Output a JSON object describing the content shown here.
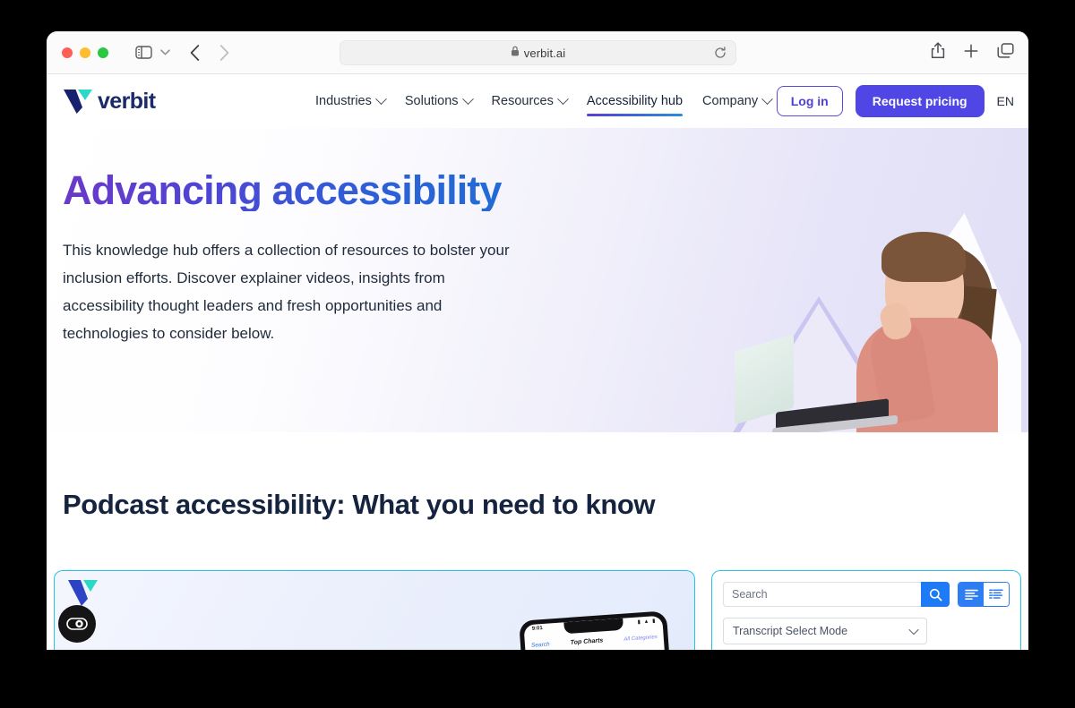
{
  "browser": {
    "url": "verbit.ai",
    "lock_icon": "lock-icon",
    "reload_icon": "reload-icon",
    "sidebar_icon": "sidebar-toggle-icon",
    "back_icon": "back-arrow-icon",
    "forward_icon": "forward-arrow-icon",
    "share_icon": "share-icon",
    "new_tab_icon": "plus-icon",
    "tab_overview_icon": "tab-overview-icon"
  },
  "header": {
    "logo_text": "verbit",
    "nav": [
      {
        "label": "Industries",
        "has_dropdown": true,
        "active": false
      },
      {
        "label": "Solutions",
        "has_dropdown": true,
        "active": false
      },
      {
        "label": "Resources",
        "has_dropdown": true,
        "active": false
      },
      {
        "label": "Accessibility hub",
        "has_dropdown": false,
        "active": true
      },
      {
        "label": "Company",
        "has_dropdown": true,
        "active": false
      }
    ],
    "login_label": "Log in",
    "request_pricing_label": "Request pricing",
    "language": "EN"
  },
  "hero": {
    "title": "Advancing accessibility",
    "paragraph": "This knowledge hub offers a collection of resources to bolster your inclusion efforts. Discover explainer videos, insights from accessibility thought leaders and fresh opportunities and technologies to consider below.",
    "image_alt": "woman-with-laptop-photo"
  },
  "section": {
    "heading": "Podcast accessibility: What you need to know"
  },
  "podcast_card": {
    "accessibility_widget_icon": "accessibility-widget-icon",
    "logo_mark_icon": "verbit-logo-mark-icon",
    "phone": {
      "status_time": "9:01",
      "status_icons": "▮ ▲ ▮",
      "back_label": "Search",
      "title": "Top Charts",
      "categories_label": "All Categories"
    }
  },
  "transcript_panel": {
    "search_placeholder": "Search",
    "search_value": "",
    "search_icon": "search-icon",
    "view_modes": [
      {
        "name": "plain-text-view",
        "icon": "align-left-icon",
        "active": true
      },
      {
        "name": "timestamped-view",
        "icon": "document-lines-icon",
        "active": false
      }
    ],
    "mode_select_label": "Transcript Select Mode",
    "mode_select_chevron": "chevron-down-icon"
  },
  "colors": {
    "brand_purple": "#4f46e5",
    "brand_navy": "#1b2a6b",
    "accent_cyan": "#21c4e8",
    "accent_blue": "#1e7bf5",
    "heading_navy": "#15233f"
  }
}
